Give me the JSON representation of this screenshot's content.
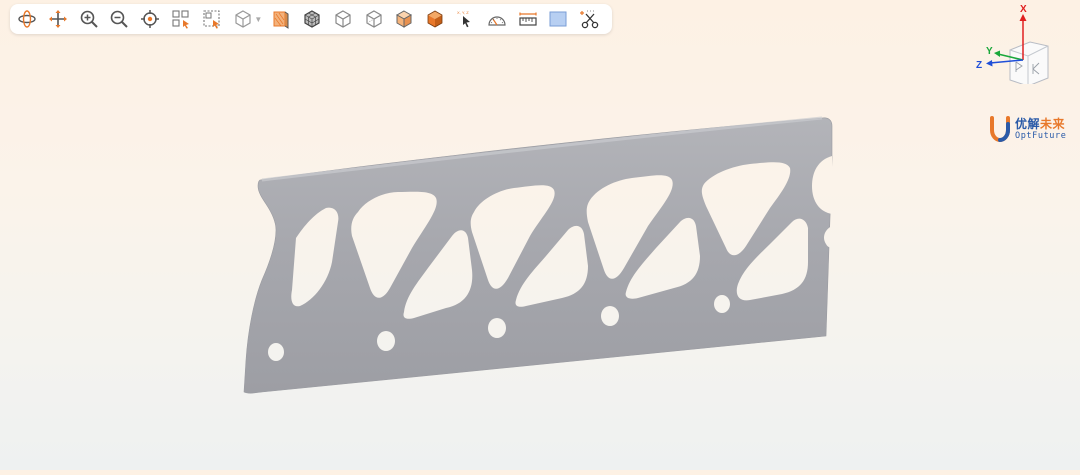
{
  "toolbar": {
    "tools": [
      {
        "icon": "rotate-icon"
      },
      {
        "icon": "pan-icon"
      },
      {
        "icon": "zoom-in-icon"
      },
      {
        "icon": "zoom-out-icon"
      },
      {
        "icon": "center-target-icon"
      },
      {
        "icon": "box-select-icon"
      },
      {
        "icon": "box-deselect-icon"
      },
      {
        "icon": "view-cube-icon"
      },
      {
        "icon": "section-plane-icon"
      },
      {
        "icon": "mesh-display-icon"
      },
      {
        "icon": "wireframe-cube-icon"
      },
      {
        "icon": "hidden-line-cube-icon"
      },
      {
        "icon": "shaded-edge-cube-icon"
      },
      {
        "icon": "shaded-cube-icon"
      },
      {
        "icon": "probe-pointer-icon"
      },
      {
        "icon": "angle-measure-icon"
      },
      {
        "icon": "ruler-measure-icon"
      },
      {
        "icon": "background-color-icon"
      },
      {
        "icon": "clip-scissors-icon"
      }
    ],
    "probe_label": "X, Y, Z"
  },
  "triad": {
    "x_label": "X",
    "y_label": "Y",
    "z_label": "Z"
  },
  "logo": {
    "cn_blue": "优解",
    "cn_orange": "未来",
    "en": "OptFuture"
  },
  "colors": {
    "accent": "#e8782a",
    "brand_blue": "#2a5aa8",
    "model_gray": "#a6a7ad"
  }
}
